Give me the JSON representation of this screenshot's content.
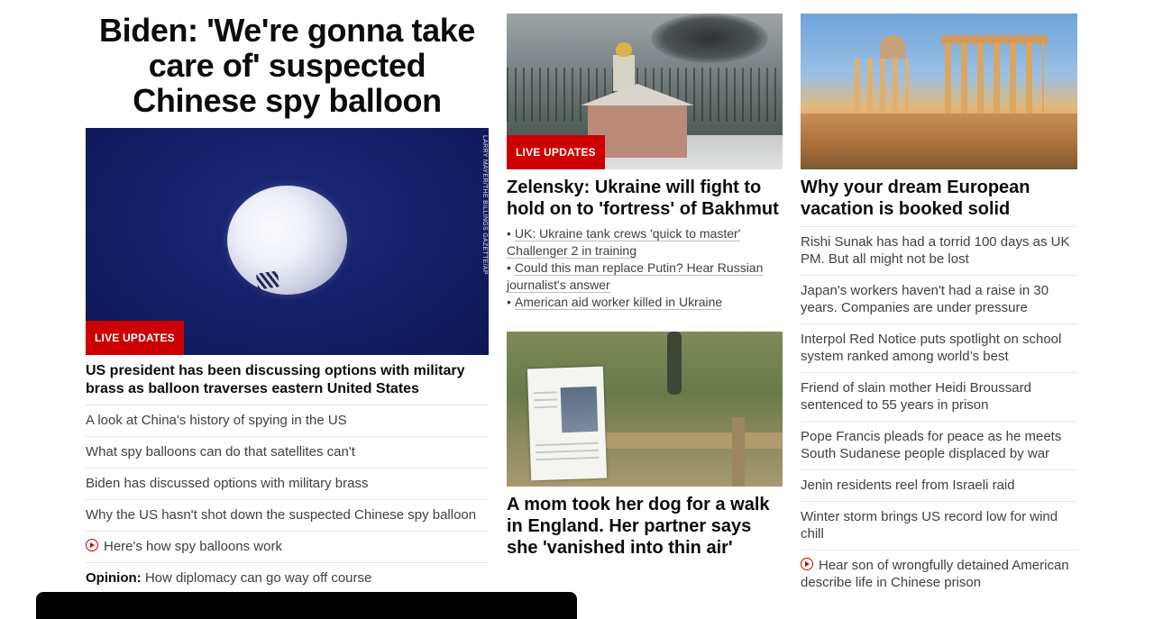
{
  "lead": {
    "title": "Biden: 'We're gonna take care of' suspected Chinese spy balloon",
    "image_credit": "LARRY MAYER/THE BILLINGS GAZETTE/AP",
    "badge": "LIVE UPDATES",
    "headline": "US president has been discussing options with military brass as balloon traverses eastern United States",
    "links": [
      {
        "text": "A look at China's history of spying in the US"
      },
      {
        "text": "What spy balloons can do that satellites can't"
      },
      {
        "text": "Biden has discussed options with military brass"
      },
      {
        "text": "Why the US hasn't shot down the suspected Chinese spy balloon"
      },
      {
        "text": "Here's how spy balloons work",
        "icon": "play-icon"
      }
    ],
    "opinion": {
      "tag": "Opinion:",
      "text": "How diplomacy can go way off course"
    }
  },
  "ukraine": {
    "badge": "LIVE UPDATES",
    "title": "Zelensky: Ukraine will fight to hold on to 'fortress' of Bakhmut",
    "bullets": [
      "UK: Ukraine tank crews 'quick to master' Challenger 2 in training",
      "Could this man replace Putin? Hear Russian journalist's answer",
      "American aid worker killed in Ukraine"
    ]
  },
  "missing": {
    "title": "A mom took her dog for a walk in England. Her partner says she 'vanished into thin air'"
  },
  "travel": {
    "title": "Why your dream European vacation is booked solid",
    "links": [
      {
        "text": "Rishi Sunak has had a torrid 100 days as UK PM. But all might not be lost"
      },
      {
        "text": "Japan's workers haven't had a raise in 30 years. Companies are under pressure"
      },
      {
        "text": "Interpol Red Notice puts spotlight on school system ranked among world’s best"
      },
      {
        "text": "Friend of slain mother Heidi Broussard sentenced to 55 years in prison"
      },
      {
        "text": "Pope Francis pleads for peace as he meets South Sudanese people displaced by war"
      },
      {
        "text": "Jenin residents reel from Israeli raid"
      },
      {
        "text": "Winter storm brings US record low for wind chill"
      },
      {
        "text": "Hear son of wrongfully detained American describe life in Chinese prison",
        "icon": "play-icon"
      }
    ]
  },
  "colors": {
    "accent_red": "#cc0000",
    "text": "#0c0c0c",
    "muted": "#404040",
    "divider": "#e6e6e6"
  }
}
